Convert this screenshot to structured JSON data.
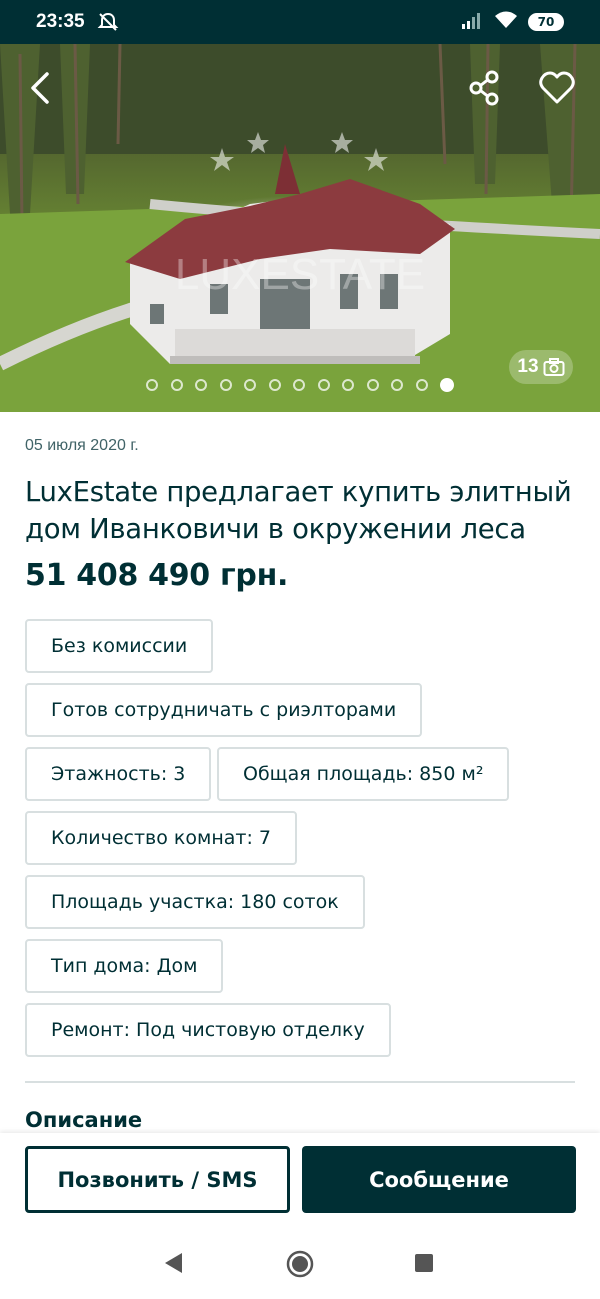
{
  "status_bar": {
    "time": "23:35",
    "battery": "70",
    "icons": [
      "mute-icon",
      "signal-icon",
      "wifi-icon",
      "battery-icon"
    ]
  },
  "hero": {
    "photo_count": "13",
    "total_photos": 13,
    "active_photo_index": 12,
    "watermark": "LUXESTATE",
    "icons": [
      "back-arrow-icon",
      "share-icon",
      "heart-icon",
      "camera-icon"
    ]
  },
  "listing": {
    "date": "05 июля 2020 г.",
    "title": "LuxEstate предлагает купить элитный дом Иванковичи в окружении леса",
    "price": "51 408 490 грн."
  },
  "tags": [
    "Без комиссии",
    "Готов сотрудничать с риэлторами",
    "Этажность: 3",
    "Общая площадь: 850 м²",
    "Количество комнат: 7",
    "Площадь участка: 180 соток",
    "Тип дома: Дом",
    "Ремонт: Под чистовую отделку"
  ],
  "description": {
    "title": "Описание"
  },
  "actions": {
    "call_label": "Позвонить / SMS",
    "message_label": "Сообщение"
  },
  "colors": {
    "brand": "#002f34",
    "tag_border": "#d8dfe0",
    "muted_text": "#406367"
  }
}
